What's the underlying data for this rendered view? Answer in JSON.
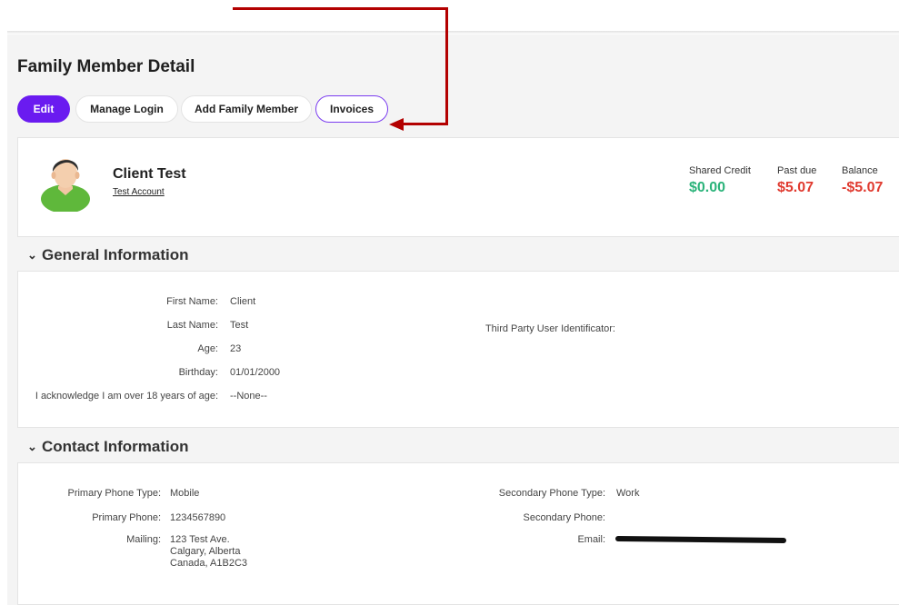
{
  "page": {
    "title": "Family Member Detail"
  },
  "toolbar": {
    "edit_label": "Edit",
    "manage_login_label": "Manage Login",
    "add_family_member_label": "Add Family Member",
    "invoices_label": "Invoices"
  },
  "colors": {
    "accent": "#6a1bf0",
    "credit": "#2bb37a",
    "debt": "#e03a2f",
    "annotation_arrow": "#b30000"
  },
  "profile": {
    "name": "Client Test",
    "account_link": "Test Account",
    "metrics": [
      {
        "label": "Shared Credit",
        "value": "$0.00"
      },
      {
        "label": "Past due",
        "value": "$5.07"
      },
      {
        "label": "Balance",
        "value": "-$5.07"
      }
    ]
  },
  "general": {
    "heading": "General Information",
    "first_name_label": "First Name:",
    "first_name": "Client",
    "last_name_label": "Last Name:",
    "last_name": "Test",
    "age_label": "Age:",
    "age": "23",
    "birthday_label": "Birthday:",
    "birthday": "01/01/2000",
    "ack_label": "I acknowledge I am over 18 years of age:",
    "ack_value": "--None--",
    "third_party_label": "Third Party User Identificator:"
  },
  "contact": {
    "heading": "Contact Information",
    "primary_phone_type_label": "Primary Phone Type:",
    "primary_phone_type": "Mobile",
    "primary_phone_label": "Primary Phone:",
    "primary_phone": "1234567890",
    "mailing_label": "Mailing:",
    "mailing_line1": "123 Test Ave.",
    "mailing_line2": "Calgary, Alberta",
    "mailing_line3": "Canada, A1B2C3",
    "secondary_phone_type_label": "Secondary Phone Type:",
    "secondary_phone_type": "Work",
    "secondary_phone_label": "Secondary Phone:",
    "email_label": "Email:"
  }
}
